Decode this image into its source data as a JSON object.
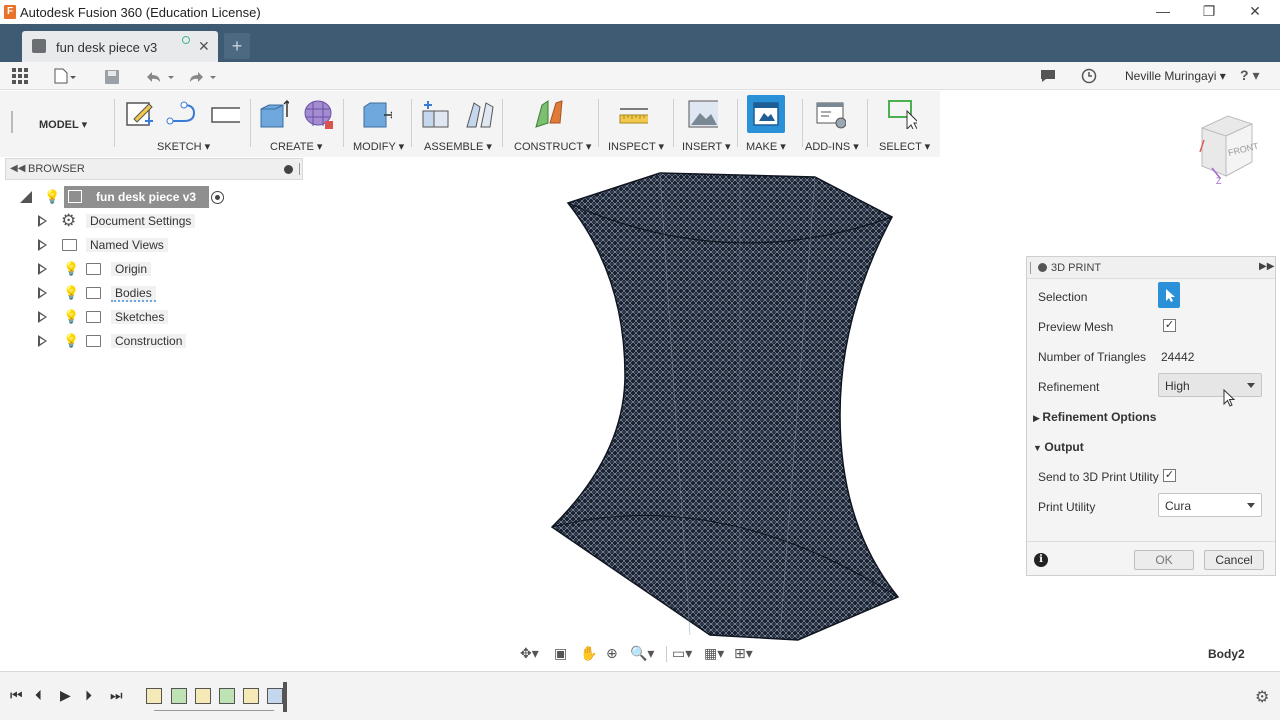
{
  "window": {
    "title": "Autodesk Fusion 360 (Education License)",
    "app_icon_letter": "F",
    "minimize": "—",
    "restore": "❐",
    "close": "✕"
  },
  "tabs": {
    "document": "fun desk piece v3",
    "close": "✕",
    "new": "+"
  },
  "quick_access": {
    "user": "Neville Muringayi ▾",
    "help": "? ▾"
  },
  "toolbar": {
    "workspace": "MODEL ▾",
    "groups": [
      "SKETCH ▾",
      "CREATE ▾",
      "MODIFY ▾",
      "ASSEMBLE ▾",
      "CONSTRUCT ▾",
      "INSPECT ▾",
      "INSERT ▾",
      "MAKE ▾",
      "ADD-INS ▾",
      "SELECT ▾"
    ]
  },
  "browser": {
    "title": "BROWSER",
    "root": "fun desk piece v3",
    "items": [
      "Document Settings",
      "Named Views",
      "Origin",
      "Bodies",
      "Sketches",
      "Construction"
    ]
  },
  "viewcube": {
    "face": "FRONT",
    "axis_x": "X",
    "axis_z": "Z"
  },
  "print_panel": {
    "title": "3D PRINT",
    "selection_label": "Selection",
    "preview_mesh_label": "Preview Mesh",
    "preview_mesh_checked": true,
    "triangles_label": "Number of Triangles",
    "triangles_value": "24442",
    "refinement_label": "Refinement",
    "refinement_value": "High",
    "refinement_options": "Refinement Options",
    "output": "Output",
    "send_label": "Send to 3D Print Utility",
    "send_checked": true,
    "utility_label": "Print Utility",
    "utility_value": "Cura",
    "ok": "OK",
    "cancel": "Cancel",
    "info": "i"
  },
  "status": {
    "body_name": "Body2"
  },
  "colors": {
    "accent": "#2a90d8",
    "tabstrip": "#3f5a73",
    "mesh": "#1b2333"
  }
}
